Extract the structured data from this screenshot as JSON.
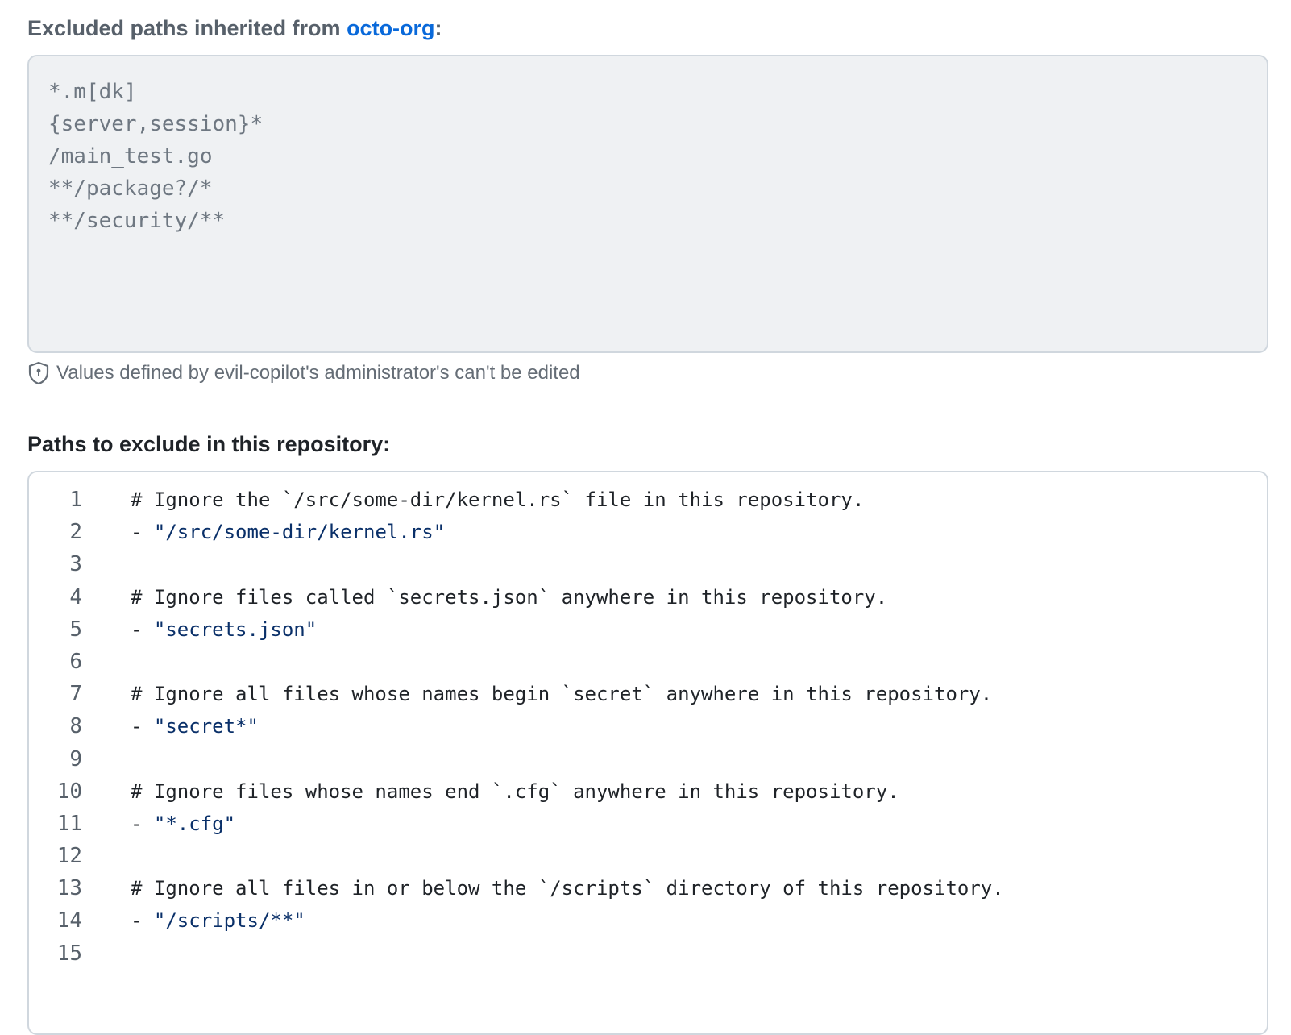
{
  "inherited": {
    "heading_prefix": "Excluded paths inherited from ",
    "org_link": "octo-org",
    "heading_suffix": ":",
    "paths": [
      "*.m[dk]",
      "{server,session}*",
      "/main_test.go",
      "**/package?/*",
      "**/security/**"
    ],
    "note": "Values defined by evil-copilot's administrator's can't be edited"
  },
  "repository": {
    "heading": "Paths to exclude in this repository:",
    "lines": [
      {
        "n": "1",
        "prefix": "# Ignore the `/src/some-dir/kernel.rs` file in this repository.",
        "str": ""
      },
      {
        "n": "2",
        "prefix": "- ",
        "str": "\"/src/some-dir/kernel.rs\""
      },
      {
        "n": "3",
        "prefix": "",
        "str": ""
      },
      {
        "n": "4",
        "prefix": "# Ignore files called `secrets.json` anywhere in this repository.",
        "str": ""
      },
      {
        "n": "5",
        "prefix": "- ",
        "str": "\"secrets.json\""
      },
      {
        "n": "6",
        "prefix": "",
        "str": ""
      },
      {
        "n": "7",
        "prefix": "# Ignore all files whose names begin `secret` anywhere in this repository.",
        "str": ""
      },
      {
        "n": "8",
        "prefix": "- ",
        "str": "\"secret*\""
      },
      {
        "n": "9",
        "prefix": "",
        "str": ""
      },
      {
        "n": "10",
        "prefix": "# Ignore files whose names end `.cfg` anywhere in this repository.",
        "str": ""
      },
      {
        "n": "11",
        "prefix": "- ",
        "str": "\"*.cfg\""
      },
      {
        "n": "12",
        "prefix": "",
        "str": ""
      },
      {
        "n": "13",
        "prefix": "# Ignore all files in or below the `/scripts` directory of this repository.",
        "str": ""
      },
      {
        "n": "14",
        "prefix": "- ",
        "str": "\"/scripts/**\""
      },
      {
        "n": "15",
        "prefix": "",
        "str": ""
      }
    ]
  }
}
